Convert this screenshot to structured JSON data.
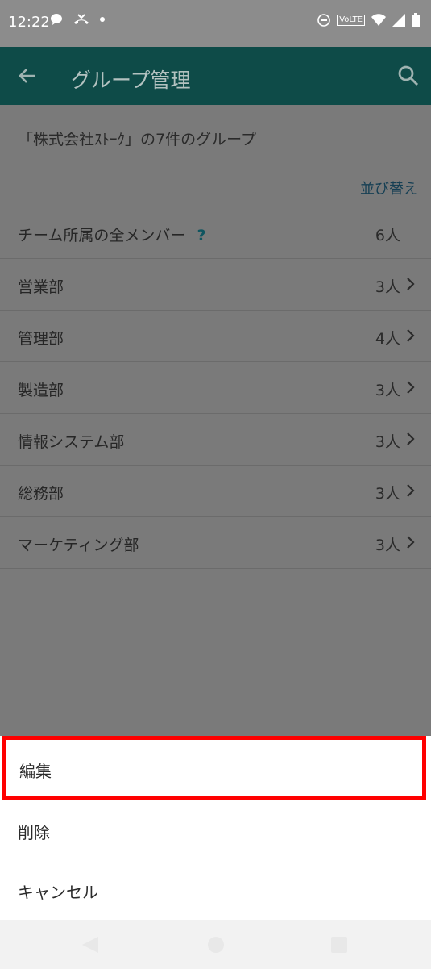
{
  "status_bar": {
    "time": "12:22",
    "volte": "VoLTE"
  },
  "app_bar": {
    "title": "グループ管理"
  },
  "header": {
    "subtitle": "「株式会社ｽﾄｰｸ」の7件のグループ",
    "sort_label": "並び替え"
  },
  "groups": [
    {
      "name": "チーム所属の全メンバー",
      "count": "6人",
      "help": "?"
    },
    {
      "name": "営業部",
      "count": "3人"
    },
    {
      "name": "管理部",
      "count": "4人"
    },
    {
      "name": "製造部",
      "count": "3人"
    },
    {
      "name": "情報システム部",
      "count": "3人"
    },
    {
      "name": "総務部",
      "count": "3人"
    },
    {
      "name": "マーケティング部",
      "count": "3人"
    }
  ],
  "sheet": {
    "edit": "編集",
    "delete": "削除",
    "cancel": "キャンセル"
  },
  "colors": {
    "app_bar": "#0e4b48",
    "highlight": "#ff0000",
    "overlay": "#7a7a7a"
  }
}
